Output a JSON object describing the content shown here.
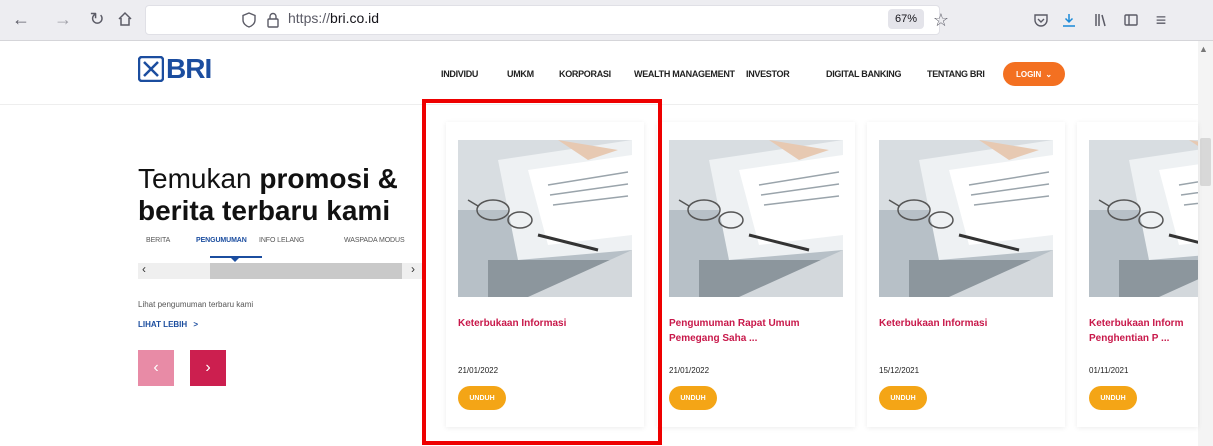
{
  "browser": {
    "url_prefix": "https://",
    "url_host": "bri.co.id",
    "zoom": "67%"
  },
  "header": {
    "logo": "BRI",
    "nav": [
      "INDIVIDU",
      "UMKM",
      "KORPORASI",
      "WEALTH MANAGEMENT",
      "INVESTOR",
      "DIGITAL BANKING",
      "TENTANG BRI"
    ],
    "login": "LOGIN"
  },
  "promo": {
    "heading_light": "Temukan",
    "heading_bold1": "promosi &",
    "heading_bold2": "berita terbaru kami",
    "tabs": [
      "BERITA",
      "PENGUMUMAN",
      "INFO LELANG",
      "WASPADA MODUS"
    ],
    "active_tab": "PENGUMUMAN",
    "description": "Lihat pengumuman terbaru kami",
    "more_link": "LIHAT LEBIH",
    "more_arrow": ">"
  },
  "cards": [
    {
      "title": "Keterbukaan Informasi",
      "date": "21/01/2022",
      "button": "UNDUH"
    },
    {
      "title": "Pengumuman Rapat Umum Pemegang Saha ...",
      "date": "21/01/2022",
      "button": "UNDUH"
    },
    {
      "title": "Keterbukaan Informasi",
      "date": "15/12/2021",
      "button": "UNDUH"
    },
    {
      "title": "Keterbukaan Inform Penghentian P ...",
      "date": "01/11/2021",
      "button": "UNDUH"
    }
  ],
  "colors": {
    "brand_blue": "#1b4d9f",
    "accent_red": "#c8184a",
    "accent_orange": "#f37021",
    "button_yellow": "#f4a516",
    "highlight": "#ee0000"
  }
}
